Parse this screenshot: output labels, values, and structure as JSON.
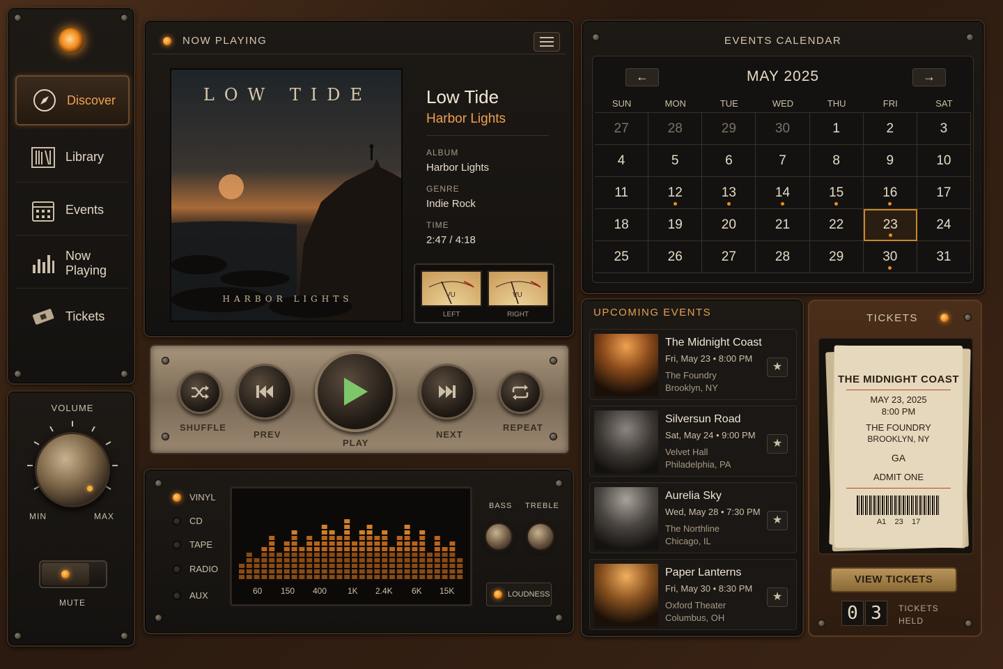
{
  "sidebar": {
    "items": [
      {
        "label": "Discover",
        "icon": "compass-icon",
        "active": true
      },
      {
        "label": "Library",
        "icon": "library-icon",
        "active": false
      },
      {
        "label": "Events",
        "icon": "calendar-icon",
        "active": false
      },
      {
        "label": "Now Playing",
        "icon": "bars-icon",
        "active": false
      },
      {
        "label": "Tickets",
        "icon": "ticket-icon",
        "active": false
      }
    ]
  },
  "volume": {
    "label": "VOLUME",
    "min": "MIN",
    "max": "MAX",
    "level": 0.85
  },
  "mute": {
    "label": "MUTE"
  },
  "now_playing": {
    "header": "NOW PLAYING",
    "cover_title": "LOW TIDE",
    "cover_subtitle": "HARBOR LIGHTS",
    "title": "Low Tide",
    "artist": "Harbor Lights",
    "album_label": "ALBUM",
    "album": "Harbor Lights",
    "genre_label": "GENRE",
    "genre": "Indie Rock",
    "time_label": "TIME",
    "time": "2:47 / 4:18",
    "vu_left": "LEFT",
    "vu_right": "RIGHT",
    "vu_text": "VU"
  },
  "transport": {
    "shuffle": "SHUFFLE",
    "prev": "PREV",
    "play": "PLAY",
    "next": "NEXT",
    "repeat": "REPEAT"
  },
  "sources": [
    "VINYL",
    "CD",
    "TAPE",
    "RADIO",
    "AUX"
  ],
  "source_active": "VINYL",
  "eq": {
    "freqs": [
      "60",
      "150",
      "400",
      "1K",
      "2.4K",
      "6K",
      "15K"
    ],
    "bass": "BASS",
    "treble": "TREBLE",
    "loudness": "LOUDNESS"
  },
  "calendar": {
    "header": "EVENTS CALENDAR",
    "month": "MAY 2025",
    "days": [
      "SUN",
      "MON",
      "TUE",
      "WED",
      "THU",
      "FRI",
      "SAT"
    ],
    "weeks": [
      [
        "27",
        "28",
        "29",
        "30",
        "1",
        "2",
        "3"
      ],
      [
        "4",
        "5",
        "6",
        "7",
        "8",
        "9",
        "10"
      ],
      [
        "11",
        "12",
        "13",
        "14",
        "15",
        "16",
        "17"
      ],
      [
        "18",
        "19",
        "20",
        "21",
        "22",
        "23",
        "24"
      ],
      [
        "25",
        "26",
        "27",
        "28",
        "29",
        "30",
        "31"
      ]
    ],
    "muted": [
      "0-0",
      "0-1",
      "0-2",
      "0-3"
    ],
    "event_days": [
      "12",
      "13",
      "14",
      "15",
      "16",
      "23",
      "30"
    ],
    "selected": "23"
  },
  "upcoming": {
    "header": "UPCOMING EVENTS",
    "events": [
      {
        "title": "The Midnight Coast",
        "date": "Fri, May 23 • 8:00 PM",
        "venue": "The Foundry",
        "city": "Brooklyn, NY"
      },
      {
        "title": "Silversun Road",
        "date": "Sat, May 24 • 9:00 PM",
        "venue": "Velvet Hall",
        "city": "Philadelphia, PA"
      },
      {
        "title": "Aurelia Sky",
        "date": "Wed, May 28 • 7:30 PM",
        "venue": "The Northline",
        "city": "Chicago, IL"
      },
      {
        "title": "Paper Lanterns",
        "date": "Fri, May 30 • 8:30 PM",
        "venue": "Oxford Theater",
        "city": "Columbus, OH"
      }
    ]
  },
  "tickets": {
    "header": "TICKETS",
    "ticket_title": "THE MIDNIGHT COAST",
    "ticket_date": "MAY 23, 2025",
    "ticket_time": "8:00 PM",
    "ticket_venue": "THE FOUNDRY",
    "ticket_city": "BROOKLYN, NY",
    "ticket_type": "GA",
    "ticket_admit": "ADMIT ONE",
    "seat": "A1    23    17",
    "view_button": "VIEW TICKETS",
    "held_digit_1": "0",
    "held_digit_2": "3",
    "held_label_1": "TICKETS",
    "held_label_2": "HELD"
  }
}
